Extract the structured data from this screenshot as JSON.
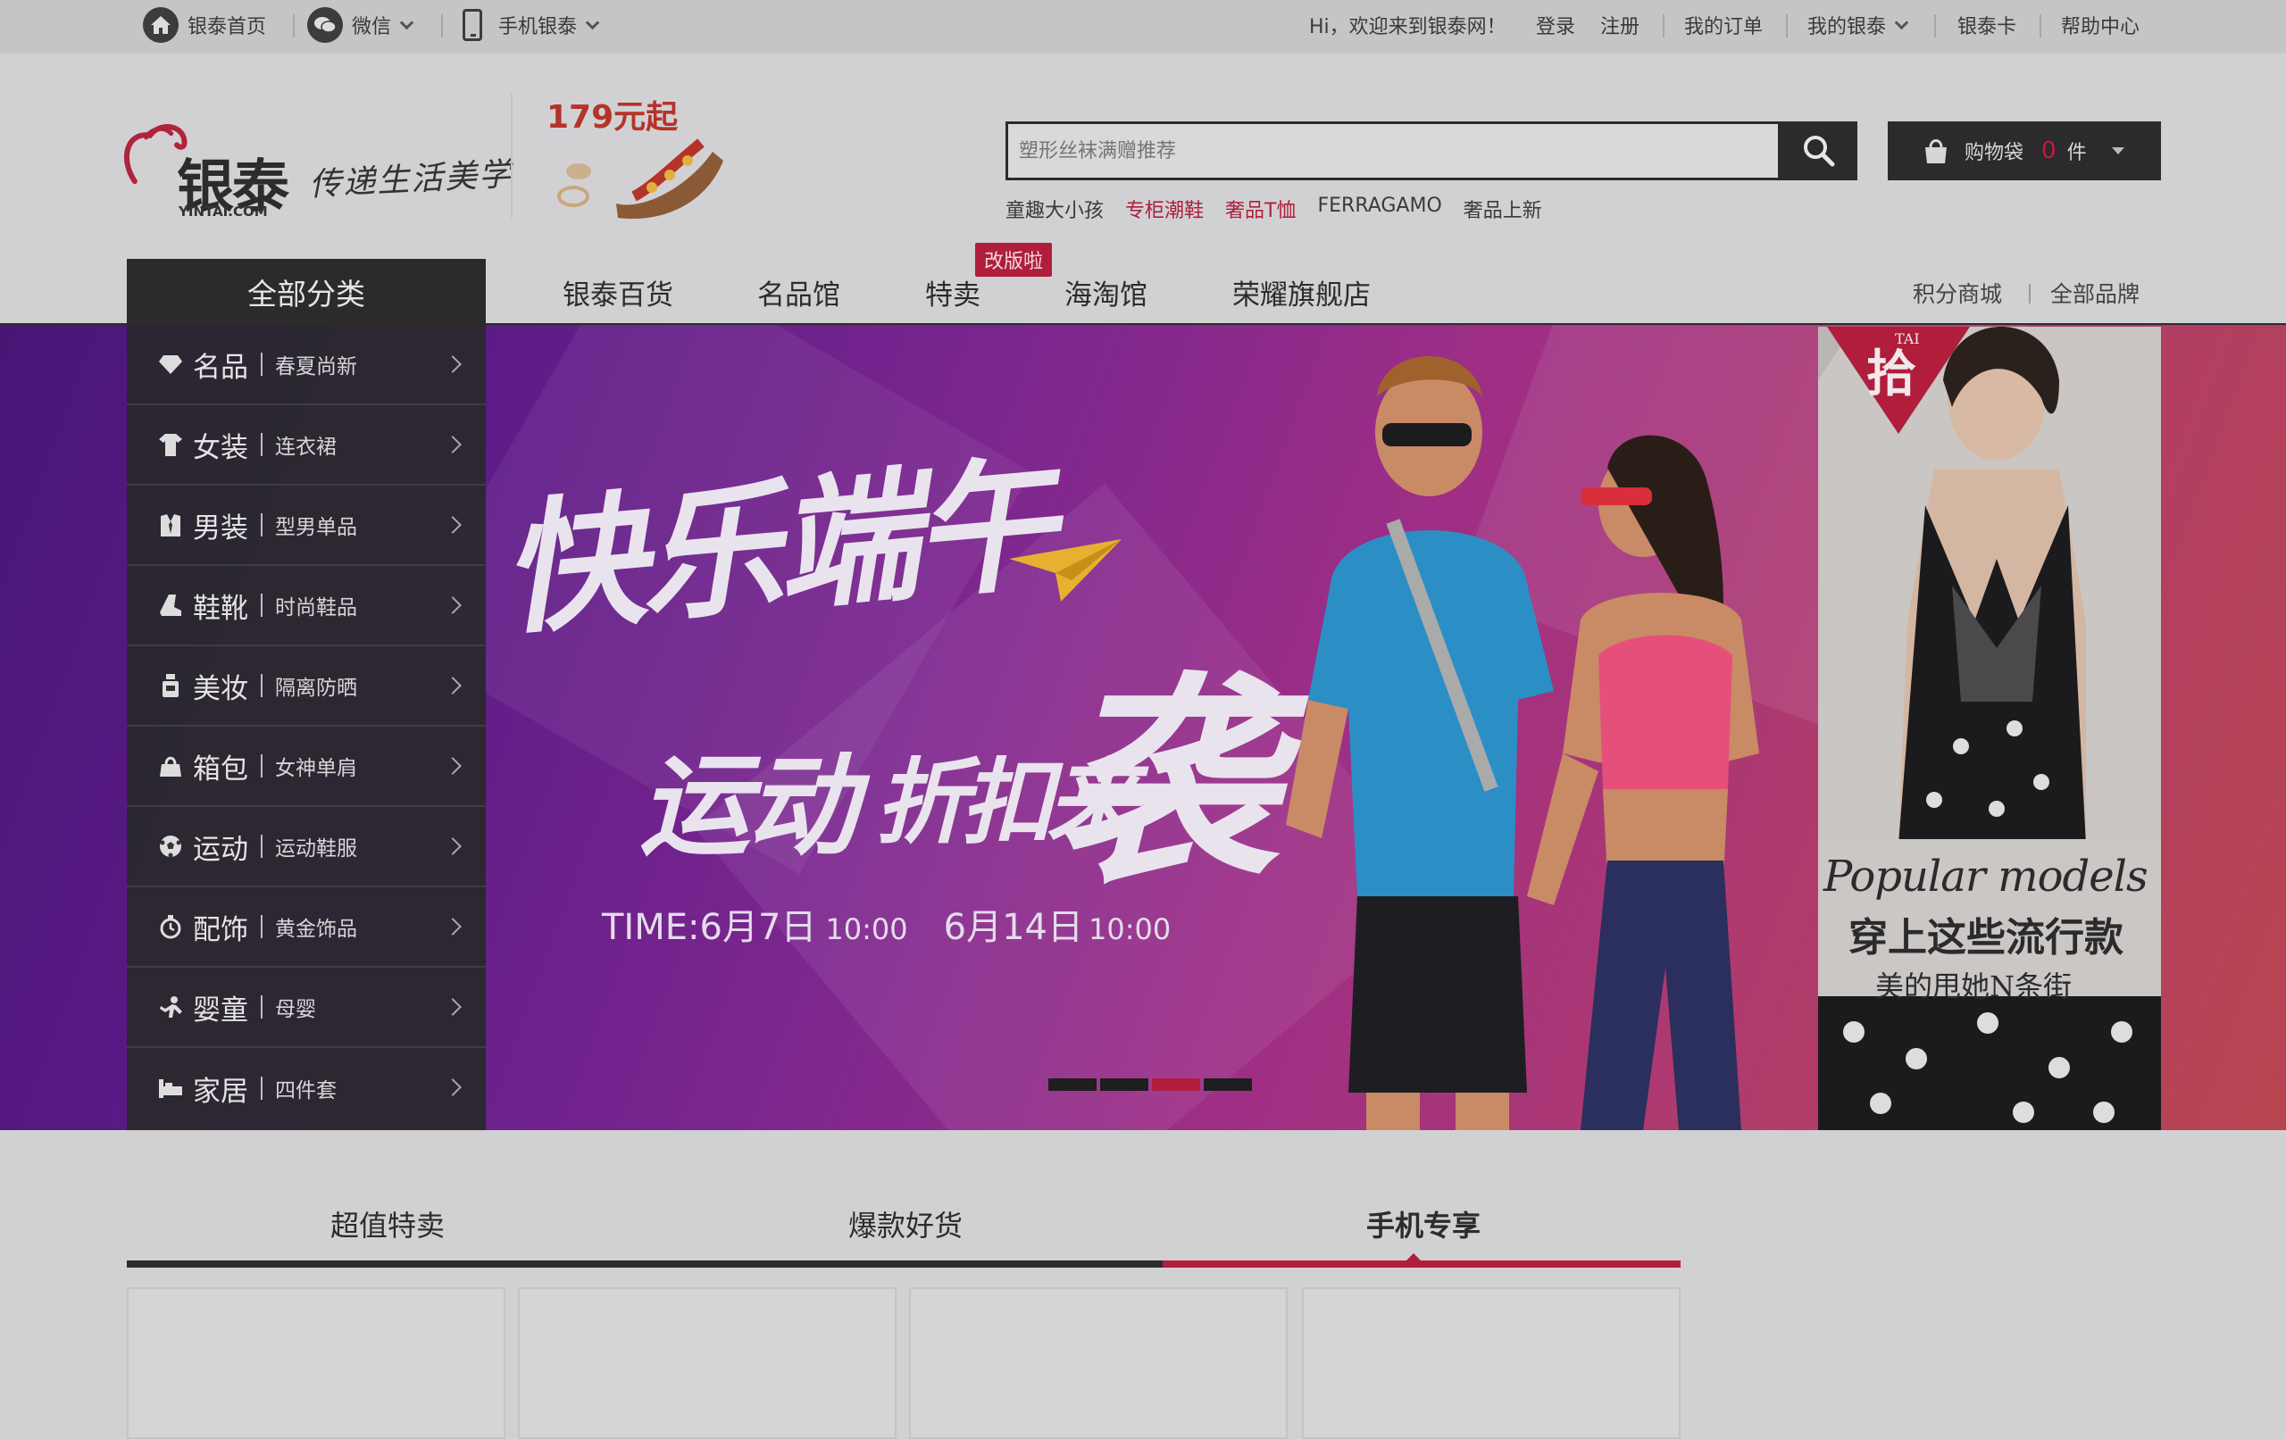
{
  "topbar": {
    "home": "银泰首页",
    "wechat": "微信",
    "mobile": "手机银泰",
    "greeting": "Hi，欢迎来到银泰网！",
    "login": "登录",
    "register": "注册",
    "orders": "我的订单",
    "my_yintai": "我的银泰",
    "card": "银泰卡",
    "help": "帮助中心"
  },
  "logo": {
    "brand_cn": "银泰",
    "brand_en": "YINTAI.COM",
    "slogan": "传递生活美学"
  },
  "promo": {
    "text": "179元起"
  },
  "search": {
    "placeholder": "塑形丝袜满赠推荐",
    "hotwords": [
      {
        "text": "童趣大小孩",
        "color": "#3a3a3a"
      },
      {
        "text": "专柜潮鞋",
        "color": "#b01e3c"
      },
      {
        "text": "奢品T恤",
        "color": "#b01e3c"
      },
      {
        "text": "FERRAGAMO",
        "color": "#3a3a3a"
      },
      {
        "text": "奢品上新",
        "color": "#3a3a3a"
      }
    ]
  },
  "cart": {
    "label": "购物袋",
    "count": "0",
    "unit": "件"
  },
  "nav": {
    "all_categories": "全部分类",
    "items": [
      "银泰百货",
      "名品馆",
      "特卖",
      "海淘馆",
      "荣耀旗舰店"
    ],
    "new_badge": "改版啦",
    "right": [
      "积分商城",
      "全部品牌"
    ]
  },
  "categories": [
    {
      "name": "名品",
      "sub": "春夏尚新",
      "icon": "diamond-icon"
    },
    {
      "name": "女装",
      "sub": "连衣裙",
      "icon": "dress-icon"
    },
    {
      "name": "男装",
      "sub": "型男单品",
      "icon": "suit-icon"
    },
    {
      "name": "鞋靴",
      "sub": "时尚鞋品",
      "icon": "boot-icon"
    },
    {
      "name": "美妆",
      "sub": "隔离防晒",
      "icon": "cosmetics-icon"
    },
    {
      "name": "箱包",
      "sub": "女神单肩",
      "icon": "handbag-icon"
    },
    {
      "name": "运动",
      "sub": "运动鞋服",
      "icon": "soccer-ball-icon"
    },
    {
      "name": "配饰",
      "sub": "黄金饰品",
      "icon": "watch-icon"
    },
    {
      "name": "婴童",
      "sub": "母婴",
      "icon": "baby-icon"
    },
    {
      "name": "家居",
      "sub": "四件套",
      "icon": "bed-icon"
    }
  ],
  "banner": {
    "line1": "快乐端午",
    "line2a": "运动",
    "line2b": "折扣来",
    "line2c": "袭",
    "time_label": "TIME:",
    "start_date": "6月7日",
    "start_time": "10:00",
    "end_date": "6月14日",
    "end_time": "10:00",
    "active_slide": 3,
    "slide_count": 4
  },
  "side_ad": {
    "brand": "拾",
    "brand_en": "TAI",
    "title": "Popular models",
    "subtitle": "穿上这些流行款",
    "tagline": "美的甩她N条街"
  },
  "tabs": [
    "超值特卖",
    "爆款好货",
    "手机专享"
  ],
  "active_tab": 2,
  "colors": {
    "accent": "#b01e3c",
    "dark": "#2b2b2d"
  }
}
